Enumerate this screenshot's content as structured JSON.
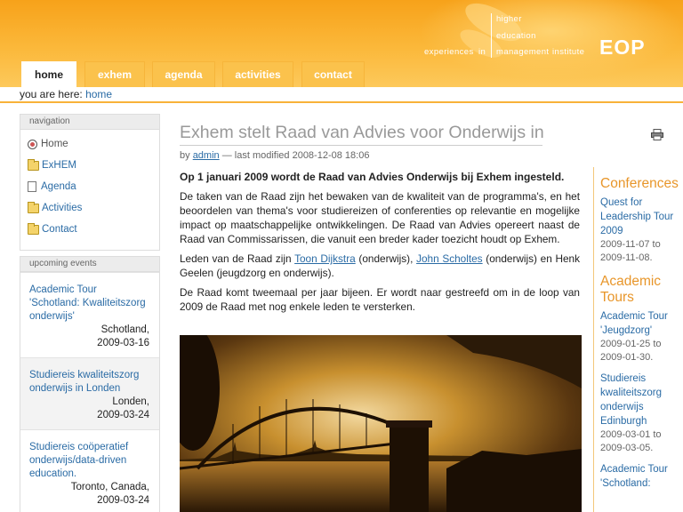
{
  "header": {
    "logo_words": [
      "higher",
      "education",
      "experiences",
      "in",
      "management",
      "institute"
    ],
    "brand": "EOP"
  },
  "tabs": [
    {
      "label": "home",
      "active": true
    },
    {
      "label": "exhem",
      "active": false
    },
    {
      "label": "agenda",
      "active": false
    },
    {
      "label": "activities",
      "active": false
    },
    {
      "label": "contact",
      "active": false
    }
  ],
  "breadcrumb": {
    "prefix": "you are here:",
    "current": "home"
  },
  "navigation": {
    "header": "navigation",
    "items": [
      {
        "label": "Home",
        "icon": "home-icon"
      },
      {
        "label": "ExHEM",
        "icon": "folder-icon"
      },
      {
        "label": "Agenda",
        "icon": "page-icon"
      },
      {
        "label": "Activities",
        "icon": "folder-icon"
      },
      {
        "label": "Contact",
        "icon": "folder-icon"
      }
    ]
  },
  "upcoming": {
    "header": "upcoming events",
    "events": [
      {
        "title": "Academic Tour 'Schotland: Kwaliteitszorg onderwijs'",
        "location": "Schotland,",
        "date": "2009-03-16"
      },
      {
        "title": "Studiereis kwaliteitszorg onderwijs in Londen",
        "location": "Londen,",
        "date": "2009-03-24"
      },
      {
        "title": "Studiereis coöperatief onderwijs/data-driven education.",
        "location": "Toronto, Canada,",
        "date": "2009-03-24"
      }
    ]
  },
  "article": {
    "title": "Exhem stelt Raad van Advies voor Onderwijs in",
    "by": "by",
    "author": "admin",
    "modified": "— last modified 2008-12-08 18:06",
    "lead": "Op 1 januari 2009 wordt de Raad van Advies Onderwijs bij Exhem ingesteld.",
    "p1": "De taken van de Raad zijn het bewaken van de kwaliteit van de programma's, en het beoordelen van thema's voor studiereizen of conferenties op relevantie en mogelijke impact op maatschappelijke ontwikkelingen. De Raad van Advies opereert naast de Raad van Commissarissen, die vanuit een breder kader toezicht houdt op Exhem.",
    "p2_a": "Leden van de Raad zijn ",
    "p2_link1": "Toon Dijkstra",
    "p2_b": " (onderwijs), ",
    "p2_link2": "John Scholtes",
    "p2_c": " (onderwijs) en Henk Geelen (jeugdzorg en onderwijs).",
    "p3": "De Raad komt tweemaal per jaar bijeen. Er wordt naar gestreefd om in de loop van 2009 de Raad met nog enkele leden te versterken."
  },
  "right": {
    "sections": [
      {
        "heading": "Conferences",
        "items": [
          {
            "title": "Quest for Leadership Tour 2009",
            "meta": "2009-11-07 to 2009-11-08."
          }
        ]
      },
      {
        "heading": "Academic Tours",
        "items": [
          {
            "title": "Academic Tour 'Jeugdzorg'",
            "meta": "2009-01-25 to 2009-01-30."
          },
          {
            "title": "Studiereis kwaliteitszorg onderwijs Edinburgh",
            "meta": "2009-03-01 to 2009-03-05."
          },
          {
            "title": "Academic Tour 'Schotland:",
            "meta": ""
          }
        ]
      }
    ]
  }
}
